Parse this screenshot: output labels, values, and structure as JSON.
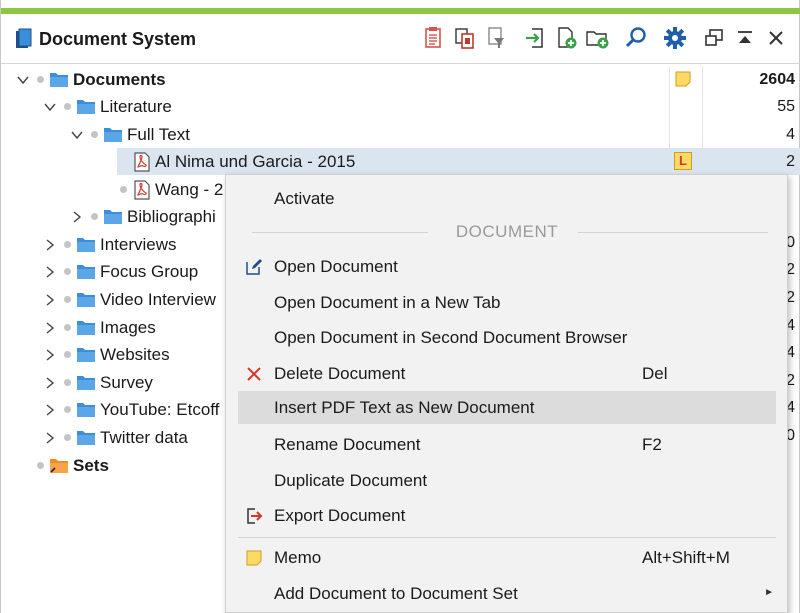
{
  "window": {
    "title": "Document System",
    "accent_color": "#8dc63f"
  },
  "toolbar": [
    {
      "name": "retrieve-documents-icon",
      "color": "#d9534f"
    },
    {
      "name": "copy-documents-icon",
      "color": "#c0392b"
    },
    {
      "name": "filter-icon",
      "color": "#555555"
    },
    {
      "name": "import-documents-icon",
      "color": "#3aa34a"
    },
    {
      "name": "new-document-icon",
      "color": "#3aa34a"
    },
    {
      "name": "new-document-group-icon",
      "color": "#3aa34a"
    },
    {
      "name": "search-icon",
      "color": "#1f5fa8"
    },
    {
      "name": "settings-gear-icon",
      "color": "#1f5fa8"
    },
    {
      "name": "undock-window-icon",
      "color": "#333333"
    },
    {
      "name": "collapse-window-icon",
      "color": "#333333"
    },
    {
      "name": "close-icon",
      "color": "#333333"
    }
  ],
  "tree": {
    "root": {
      "label": "Documents",
      "count": "2604"
    },
    "literature": {
      "label": "Literature",
      "count": "55"
    },
    "fulltext": {
      "label": "Full Text",
      "count": "4"
    },
    "doc1": {
      "label": "Al Nima und Garcia - 2015",
      "count": "2",
      "badge": "L"
    },
    "doc2": {
      "label": "Wang - 2"
    },
    "bibliographic": {
      "label": "Bibliographi"
    },
    "groups": [
      {
        "label": "Interviews",
        "count": "0"
      },
      {
        "label": "Focus Group",
        "count": "2"
      },
      {
        "label": "Video Interview",
        "count": "2"
      },
      {
        "label": "Images",
        "count": "4"
      },
      {
        "label": "Websites",
        "count": "4"
      },
      {
        "label": "Survey",
        "count": "2"
      },
      {
        "label": "YouTube: Etcoff",
        "count": "4"
      },
      {
        "label": "Twitter data",
        "count": "0"
      }
    ],
    "sets": {
      "label": "Sets"
    }
  },
  "context_menu": {
    "activate": "Activate",
    "section_label": "DOCUMENT",
    "items": [
      {
        "label": "Open Document",
        "shortcut": "",
        "icon": "edit-pencil-icon"
      },
      {
        "label": "Open Document in a New Tab",
        "shortcut": ""
      },
      {
        "label": "Open Document in Second Document Browser",
        "shortcut": ""
      },
      {
        "label": "Delete Document",
        "shortcut": "Del",
        "icon": "delete-x-icon"
      },
      {
        "label": "Insert PDF Text as New Document",
        "shortcut": "",
        "highlighted": true
      },
      {
        "label": "Rename Document",
        "shortcut": "F2"
      },
      {
        "label": "Duplicate Document",
        "shortcut": ""
      },
      {
        "label": "Export Document",
        "shortcut": "",
        "icon": "export-icon"
      }
    ],
    "memo": {
      "label": "Memo",
      "shortcut": "Alt+Shift+M",
      "icon": "memo-icon"
    },
    "add_to_set": {
      "label": "Add Document to Document Set"
    }
  },
  "colors": {
    "folder_blue": "#3b8fd9",
    "folder_orange": "#f08c28",
    "selection": "#dbe5ef",
    "memo_yellow": "#ffd966",
    "delete_red": "#d9362b"
  }
}
